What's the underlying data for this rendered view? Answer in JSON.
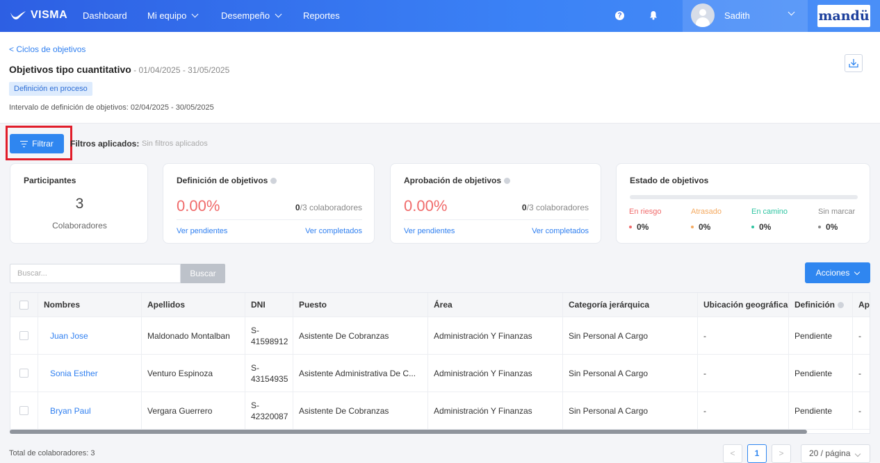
{
  "nav": {
    "brand": "VISMA",
    "items": [
      {
        "label": "Dashboard",
        "has_dropdown": false
      },
      {
        "label": "Mi equipo",
        "has_dropdown": true
      },
      {
        "label": "Desempeño",
        "has_dropdown": true
      },
      {
        "label": "Reportes",
        "has_dropdown": false
      }
    ],
    "help_icon": "?",
    "user_name": "Sadith",
    "partner_brand": "mandü"
  },
  "header": {
    "back_link": "< Ciclos de objetivos",
    "title": "Objetivos tipo cuantitativo",
    "date_range": " - 01/04/2025 - 31/05/2025",
    "status": "Definición en proceso",
    "interval": "Intervalo de definición de objetivos: 02/04/2025 - 30/05/2025"
  },
  "filters": {
    "button_label": "Filtrar",
    "applied_label": "Filtros aplicados:",
    "applied_value": "Sin filtros aplicados"
  },
  "cards": {
    "participants": {
      "title": "Participantes",
      "count": "3",
      "caption": "Colaboradores"
    },
    "definition": {
      "title": "Definición de objetivos",
      "percent": "0.00%",
      "done": "0",
      "total_text": "/3 colaboradores",
      "pending_link": "Ver pendientes",
      "completed_link": "Ver completados"
    },
    "approval": {
      "title": "Aprobación de objetivos",
      "percent": "0.00%",
      "done": "0",
      "total_text": "/3 colaboradores",
      "pending_link": "Ver pendientes",
      "completed_link": "Ver completados"
    },
    "status": {
      "title": "Estado de objetivos",
      "states": [
        {
          "label": "En riesgo",
          "value": "0%",
          "color": "#f06a6a"
        },
        {
          "label": "Atrasado",
          "value": "0%",
          "color": "#f4a95f"
        },
        {
          "label": "En camino",
          "value": "0%",
          "color": "#2ec4a1"
        },
        {
          "label": "Sin marcar",
          "value": "0%",
          "color": "#888888"
        }
      ]
    }
  },
  "search": {
    "placeholder": "Buscar...",
    "button": "Buscar"
  },
  "actions_label": "Acciones",
  "table": {
    "columns": [
      "Nombres",
      "Apellidos",
      "DNI",
      "Puesto",
      "Área",
      "Categoría jerárquica",
      "Ubicación geográfica",
      "Definición",
      "Ap"
    ],
    "rows": [
      {
        "nombres": "Juan Jose",
        "apellidos": "Maldonado Montalban",
        "dni_prefix": "S-",
        "dni_num": "41598912",
        "puesto": "Asistente De Cobranzas",
        "area": "Administración Y Finanzas",
        "categoria": "Sin Personal A Cargo",
        "ubicacion": "-",
        "definicion": "Pendiente",
        "ap": "-"
      },
      {
        "nombres": "Sonia Esther",
        "apellidos": "Venturo Espinoza",
        "dni_prefix": "S-",
        "dni_num": "43154935",
        "puesto": "Asistente Administrativa De C...",
        "area": "Administración Y Finanzas",
        "categoria": "Sin Personal A Cargo",
        "ubicacion": "-",
        "definicion": "Pendiente",
        "ap": "-"
      },
      {
        "nombres": "Bryan Paul",
        "apellidos": "Vergara Guerrero",
        "dni_prefix": "S-",
        "dni_num": "42320087",
        "puesto": "Asistente De Cobranzas",
        "area": "Administración Y Finanzas",
        "categoria": "Sin Personal A Cargo",
        "ubicacion": "-",
        "definicion": "Pendiente",
        "ap": "-"
      }
    ]
  },
  "footer": {
    "total": "Total de colaboradores: 3",
    "prev": "<",
    "current_page": "1",
    "next": ">",
    "per_page": "20 / página"
  }
}
